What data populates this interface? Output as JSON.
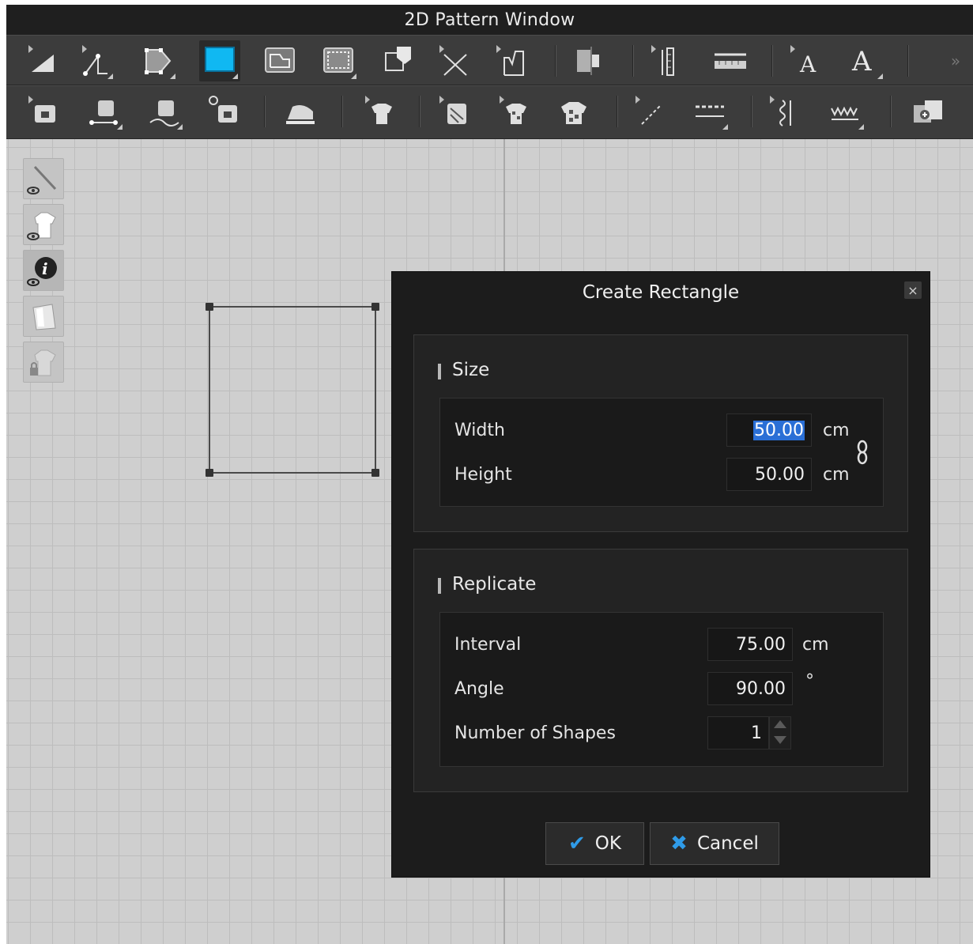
{
  "window": {
    "title": "2D Pattern Window"
  },
  "toolbar1": {
    "tools": [
      "edit-pattern-icon",
      "edit-point-icon",
      "transform-pattern-icon",
      "rectangle-icon",
      "polygon-icon",
      "internal-rectangle-icon",
      "trace-icon",
      "segment-icon",
      "dart-icon",
      "fold-arrangement-icon",
      "ruler-icon",
      "tape-measure-icon",
      "text-icon",
      "text-style-icon"
    ],
    "more_label": "»"
  },
  "toolbar2": {
    "tools": [
      "sewing-icon",
      "segment-sewing-icon",
      "free-sewing-icon",
      "check-sewing-icon",
      "iron-icon",
      "select-mesh-icon",
      "texture-edit-icon",
      "fabric-icon",
      "fabric-assign-icon",
      "line-icon",
      "topstitch-icon",
      "elastic-icon",
      "zigzag-icon",
      "add-pattern-icon"
    ]
  },
  "sidebar": {
    "buttons": [
      "show-pattern-icon",
      "show-garment-icon",
      "show-info-icon",
      "pattern-sheet-icon",
      "lock-garment-icon"
    ]
  },
  "dialog": {
    "title": "Create Rectangle",
    "close_label": "×",
    "size_section": {
      "title": "Size",
      "width_label": "Width",
      "width_value": "50.00",
      "height_label": "Height",
      "height_value": "50.00",
      "unit": "cm",
      "link_icon": "chain-link-icon"
    },
    "replicate_section": {
      "title": "Replicate",
      "interval_label": "Interval",
      "interval_value": "75.00",
      "interval_unit": "cm",
      "angle_label": "Angle",
      "angle_value": "90.00",
      "angle_unit": "°",
      "count_label": "Number of Shapes",
      "count_value": "1"
    },
    "ok_label": "OK",
    "cancel_label": "Cancel"
  },
  "colors": {
    "accent": "#2f9be8",
    "selection": "#2a6fd6",
    "rect_tool": "#10b8f2"
  }
}
